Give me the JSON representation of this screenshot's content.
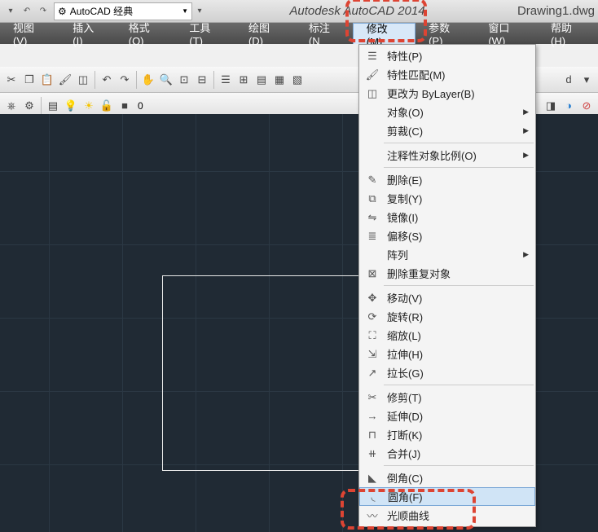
{
  "title": {
    "app": "Autodesk AutoCAD 2014",
    "doc": "Drawing1.dwg",
    "workspace": "AutoCAD 经典"
  },
  "menubar": {
    "view": "视图(V)",
    "insert": "插入(I)",
    "format": "格式(O)",
    "tools": "工具(T)",
    "draw": "绘图(D)",
    "dimension": "标注(N",
    "modify": "修改(M)",
    "parametric": "参数(P)",
    "window": "窗口(W)",
    "help": "帮助(H)"
  },
  "layer": {
    "name": "0"
  },
  "modify_menu": {
    "properties": "特性(P)",
    "matchprop": "特性匹配(M)",
    "bylayer": "更改为 ByLayer(B)",
    "object": "对象(O)",
    "clip": "剪裁(C)",
    "anno_scale": "注释性对象比例(O)",
    "erase": "删除(E)",
    "copy": "复制(Y)",
    "mirror": "镜像(I)",
    "offset": "偏移(S)",
    "array": "阵列",
    "overkill": "删除重复对象",
    "move": "移动(V)",
    "rotate": "旋转(R)",
    "scale": "缩放(L)",
    "stretch": "拉伸(H)",
    "lengthen": "拉长(G)",
    "trim": "修剪(T)",
    "extend": "延伸(D)",
    "break": "打断(K)",
    "join": "合并(J)",
    "chamfer": "倒角(C)",
    "fillet": "圆角(F)",
    "blend": "光顺曲线"
  }
}
